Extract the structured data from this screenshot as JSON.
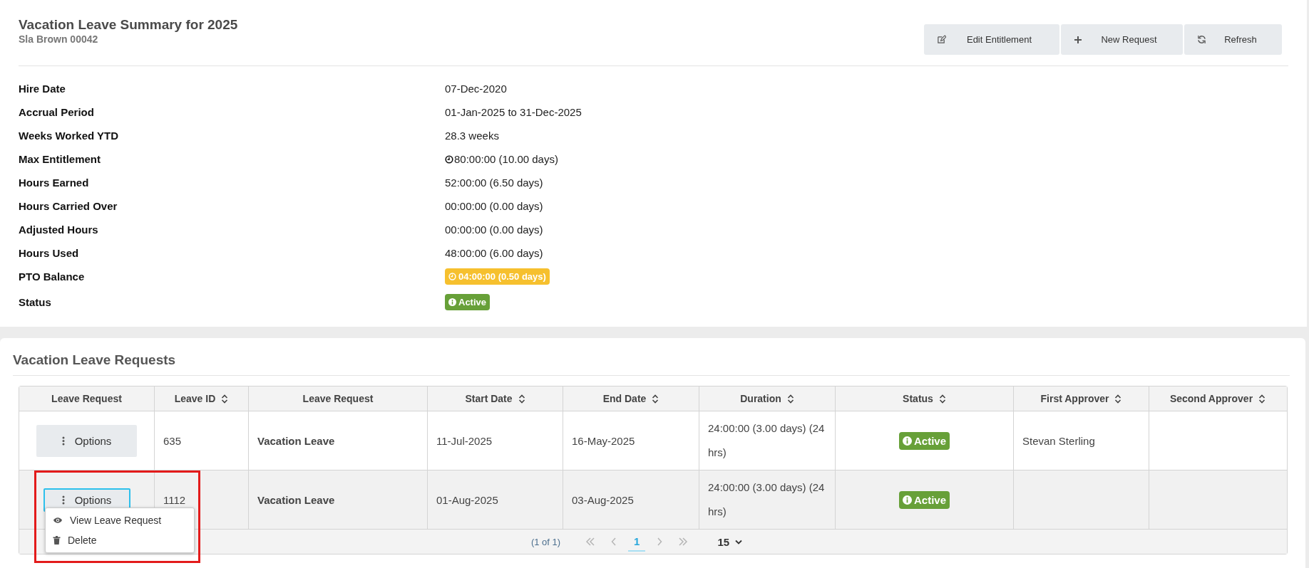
{
  "summary": {
    "title": "Vacation Leave Summary for 2025",
    "subtitle": "Sla Brown 00042",
    "actions": [
      {
        "kind": "edit",
        "label": "Edit Entitlement"
      },
      {
        "kind": "add",
        "label": "New Request"
      },
      {
        "kind": "refresh",
        "label": "Refresh"
      }
    ],
    "details": [
      {
        "label": "Hire Date",
        "kind": "text",
        "value": "07-Dec-2020"
      },
      {
        "label": "Accrual Period",
        "kind": "text",
        "value": "01-Jan-2025 to 31-Dec-2025"
      },
      {
        "label": "Weeks Worked YTD",
        "kind": "text",
        "value": "28.3 weeks"
      },
      {
        "label": "Max Entitlement",
        "kind": "clock",
        "value": "80:00:00 (10.00 days)"
      },
      {
        "label": "Hours Earned",
        "kind": "text",
        "value": "52:00:00 (6.50 days)"
      },
      {
        "label": "Hours Carried Over",
        "kind": "text",
        "value": "00:00:00 (0.00 days)"
      },
      {
        "label": "Adjusted Hours",
        "kind": "text",
        "value": "00:00:00 (0.00 days)"
      },
      {
        "label": "Hours Used",
        "kind": "text",
        "value": "48:00:00 (6.00 days)"
      },
      {
        "label": "PTO Balance",
        "kind": "clock-badge",
        "value": "04:00:00 (0.50 days)",
        "color": "#f6c02e"
      },
      {
        "label": "Status",
        "kind": "info-badge",
        "value": "Active",
        "color": "#67a038"
      }
    ]
  },
  "requests": {
    "title": "Vacation Leave Requests",
    "columns": [
      {
        "label": "Leave Request",
        "sortable": false
      },
      {
        "label": "Leave ID",
        "sortable": true
      },
      {
        "label": "Leave Request",
        "sortable": false
      },
      {
        "label": "Start Date",
        "sortable": true
      },
      {
        "label": "End Date",
        "sortable": true
      },
      {
        "label": "Duration",
        "sortable": true
      },
      {
        "label": "Status",
        "sortable": true
      },
      {
        "label": "First Approver",
        "sortable": true
      },
      {
        "label": "Second Approver",
        "sortable": true
      }
    ],
    "rows": [
      {
        "selected": false,
        "options": {
          "label": "Options",
          "focused": false
        },
        "leave_id": "635",
        "type": "Vacation Leave",
        "start": "11-Jul-2025",
        "end": "16-May-2025",
        "duration": "24:00:00 (3.00 days) (24 hrs)",
        "status": {
          "label": "Active",
          "color": "#67a038"
        },
        "first_approver": "Stevan Sterling"
      },
      {
        "selected": true,
        "options": {
          "label": "Options",
          "focused": true,
          "menu": [
            {
              "kind": "view",
              "label": "View Leave Request"
            },
            {
              "kind": "delete",
              "label": "Delete"
            }
          ]
        },
        "leave_id": "1112",
        "type": "Vacation Leave",
        "start": "01-Aug-2025",
        "end": "03-Aug-2025",
        "duration": "24:00:00 (3.00 days) (24 hrs)",
        "status": {
          "label": "Active",
          "color": "#67a038"
        }
      }
    ],
    "pagination": {
      "summary": "(1 of 1)",
      "first_disabled": true,
      "prev_disabled": true,
      "pages": [
        {
          "label": "1",
          "selected": true
        }
      ],
      "next_disabled": true,
      "last_disabled": true,
      "rows_per_page": "15"
    }
  },
  "annotation": {
    "highlight": true
  }
}
